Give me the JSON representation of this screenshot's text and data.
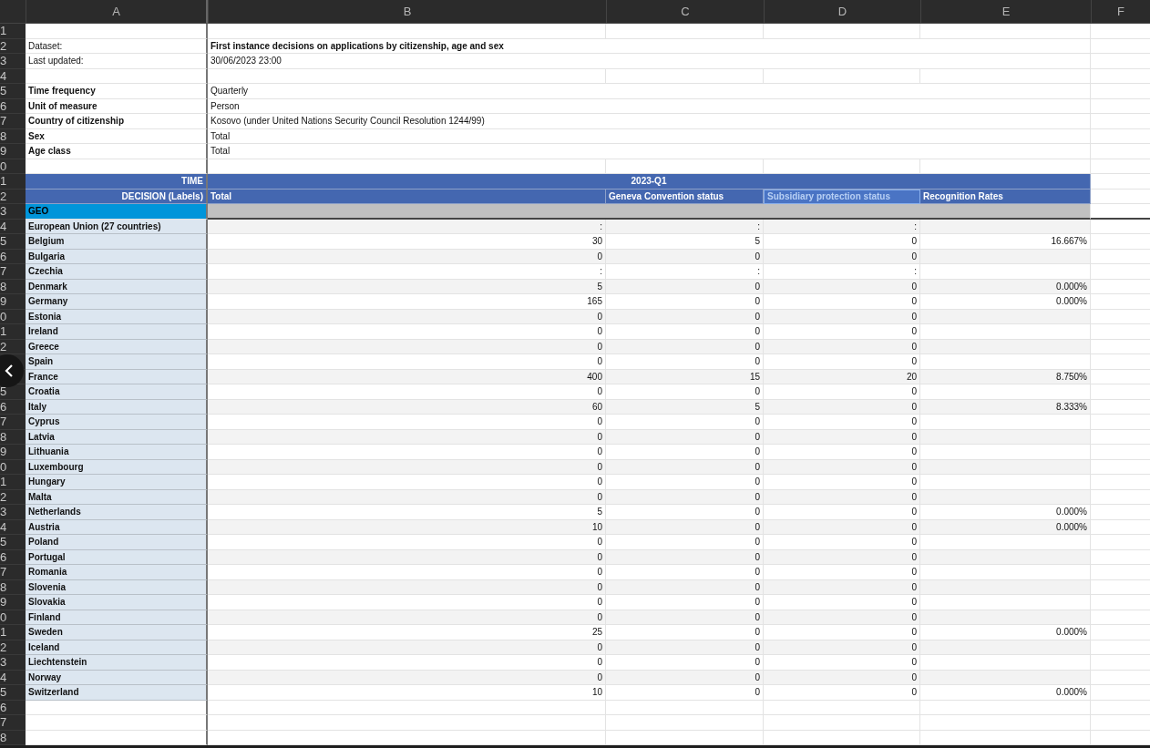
{
  "columns": [
    "A",
    "B",
    "C",
    "D",
    "E",
    "F"
  ],
  "row_numbers_above_button": [
    "1",
    "2",
    "3",
    "4",
    "5",
    "6",
    "7",
    "8",
    "9",
    "0",
    "1",
    "2",
    "3",
    "4",
    "5",
    "6",
    "7",
    "8",
    "9",
    "0",
    "1",
    "2"
  ],
  "row_numbers_below_button": [
    "5",
    "6",
    "7",
    "8",
    "9",
    "0",
    "1",
    "2",
    "3",
    "4",
    "5",
    "6",
    "7",
    "8",
    "9",
    "0",
    "1",
    "2",
    "3",
    "4",
    "5",
    "6",
    "7",
    "8"
  ],
  "metadata_groups": [
    {
      "items": [
        {
          "kind": "title",
          "label": "Dataset:",
          "value": "First instance decisions on applications by citizenship, age and sex"
        },
        {
          "kind": "info",
          "label": "Last updated:",
          "value": "30/06/2023 23:00"
        }
      ]
    },
    {
      "items": [
        {
          "kind": "dimension",
          "label": "Time frequency",
          "value": "Quarterly"
        },
        {
          "kind": "dimension",
          "label": "Unit of measure",
          "value": "Person"
        },
        {
          "kind": "dimension",
          "label": "Country of citizenship",
          "value": "Kosovo (under United Nations Security Council Resolution 1244/99)"
        },
        {
          "kind": "dimension",
          "label": "Sex",
          "value": "Total"
        },
        {
          "kind": "dimension",
          "label": "Age class",
          "value": "Total"
        }
      ]
    }
  ],
  "header": {
    "time_label": "TIME",
    "time_value": "2023-Q1",
    "decision_label": "DECISION (Labels)",
    "geo_label": "GEO",
    "decisions": [
      {
        "label": "Total",
        "selected": false
      },
      {
        "label": "Geneva Convention status",
        "selected": false
      },
      {
        "label": "Subsidiary protection status",
        "selected": true
      },
      {
        "label": "Recognition Rates",
        "selected": false
      }
    ]
  },
  "rows": [
    {
      "geo": "European Union (27 countries)",
      "values": [
        ":",
        ":",
        ":"
      ]
    },
    {
      "geo": "Belgium",
      "values": [
        "30",
        "5",
        "0",
        "16.667%"
      ]
    },
    {
      "geo": "Bulgaria",
      "values": [
        "0",
        "0",
        "0"
      ]
    },
    {
      "geo": "Czechia",
      "values": [
        ":",
        ":",
        ":"
      ]
    },
    {
      "geo": "Denmark",
      "values": [
        "5",
        "0",
        "0",
        "0.000%"
      ]
    },
    {
      "geo": "Germany",
      "values": [
        "165",
        "0",
        "0",
        "0.000%"
      ]
    },
    {
      "geo": "Estonia",
      "values": [
        "0",
        "0",
        "0"
      ]
    },
    {
      "geo": "Ireland",
      "values": [
        "0",
        "0",
        "0"
      ]
    },
    {
      "geo": "Greece",
      "values": [
        "0",
        "0",
        "0"
      ]
    },
    {
      "geo": "Spain",
      "values": [
        "0",
        "0",
        "0"
      ]
    },
    {
      "geo": "France",
      "values": [
        "400",
        "15",
        "20",
        "8.750%"
      ]
    },
    {
      "geo": "Croatia",
      "values": [
        "0",
        "0",
        "0"
      ]
    },
    {
      "geo": "Italy",
      "values": [
        "60",
        "5",
        "0",
        "8.333%"
      ]
    },
    {
      "geo": "Cyprus",
      "values": [
        "0",
        "0",
        "0"
      ]
    },
    {
      "geo": "Latvia",
      "values": [
        "0",
        "0",
        "0"
      ]
    },
    {
      "geo": "Lithuania",
      "values": [
        "0",
        "0",
        "0"
      ]
    },
    {
      "geo": "Luxembourg",
      "values": [
        "0",
        "0",
        "0"
      ]
    },
    {
      "geo": "Hungary",
      "values": [
        "0",
        "0",
        "0"
      ]
    },
    {
      "geo": "Malta",
      "values": [
        "0",
        "0",
        "0"
      ]
    },
    {
      "geo": "Netherlands",
      "values": [
        "5",
        "0",
        "0",
        "0.000%"
      ]
    },
    {
      "geo": "Austria",
      "values": [
        "10",
        "0",
        "0",
        "0.000%"
      ]
    },
    {
      "geo": "Poland",
      "values": [
        "0",
        "0",
        "0"
      ]
    },
    {
      "geo": "Portugal",
      "values": [
        "0",
        "0",
        "0"
      ]
    },
    {
      "geo": "Romania",
      "values": [
        "0",
        "0",
        "0"
      ]
    },
    {
      "geo": "Slovenia",
      "values": [
        "0",
        "0",
        "0"
      ]
    },
    {
      "geo": "Slovakia",
      "values": [
        "0",
        "0",
        "0"
      ]
    },
    {
      "geo": "Finland",
      "values": [
        "0",
        "0",
        "0"
      ]
    },
    {
      "geo": "Sweden",
      "values": [
        "25",
        "0",
        "0",
        "0.000%"
      ]
    },
    {
      "geo": "Iceland",
      "values": [
        "0",
        "0",
        "0"
      ]
    },
    {
      "geo": "Liechtenstein",
      "values": [
        "0",
        "0",
        "0"
      ]
    },
    {
      "geo": "Norway",
      "values": [
        "0",
        "0",
        "0"
      ]
    },
    {
      "geo": "Switzerland",
      "values": [
        "10",
        "0",
        "0",
        "0.000%"
      ]
    }
  ]
}
